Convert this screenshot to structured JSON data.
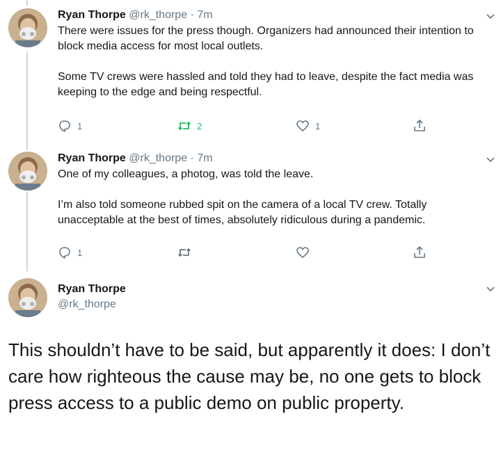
{
  "tweets": [
    {
      "name": "Ryan Thorpe",
      "handle": "@rk_thorpe",
      "time": "· 7m",
      "paragraphs": [
        "There were issues for the press though. Organizers had announced their intention to block media access for most local outlets.",
        "Some TV crews were hassled and told they had to leave, despite the fact media was keeping to the edge and being respectful."
      ],
      "reply_count": "1",
      "retweet_count": "2",
      "like_count": "1"
    },
    {
      "name": "Ryan Thorpe",
      "handle": "@rk_thorpe",
      "time": "· 7m",
      "paragraphs": [
        "One of my colleagues, a photog, was told the leave.",
        "I’m also told someone rubbed spit on the camera of a local TV crew. Totally unacceptable at the best of times, absolutely ridiculous during a pandemic."
      ],
      "reply_count": "1",
      "retweet_count": "",
      "like_count": ""
    }
  ],
  "main_tweet": {
    "name": "Ryan Thorpe",
    "handle": "@rk_thorpe",
    "text": "This shouldn’t have to be said, but apparently it does: I don’t care how righteous the cause may be, no one gets to block press access to a public demo on public property."
  },
  "icons": {
    "reply": "reply-icon",
    "retweet": "retweet-icon",
    "like": "heart-icon",
    "share": "share-icon",
    "more": "chevron-down-icon"
  },
  "colors": {
    "text": "#14171a",
    "muted": "#657786",
    "retweet_active": "#17bf63",
    "thread_line": "#ccd6dd"
  }
}
